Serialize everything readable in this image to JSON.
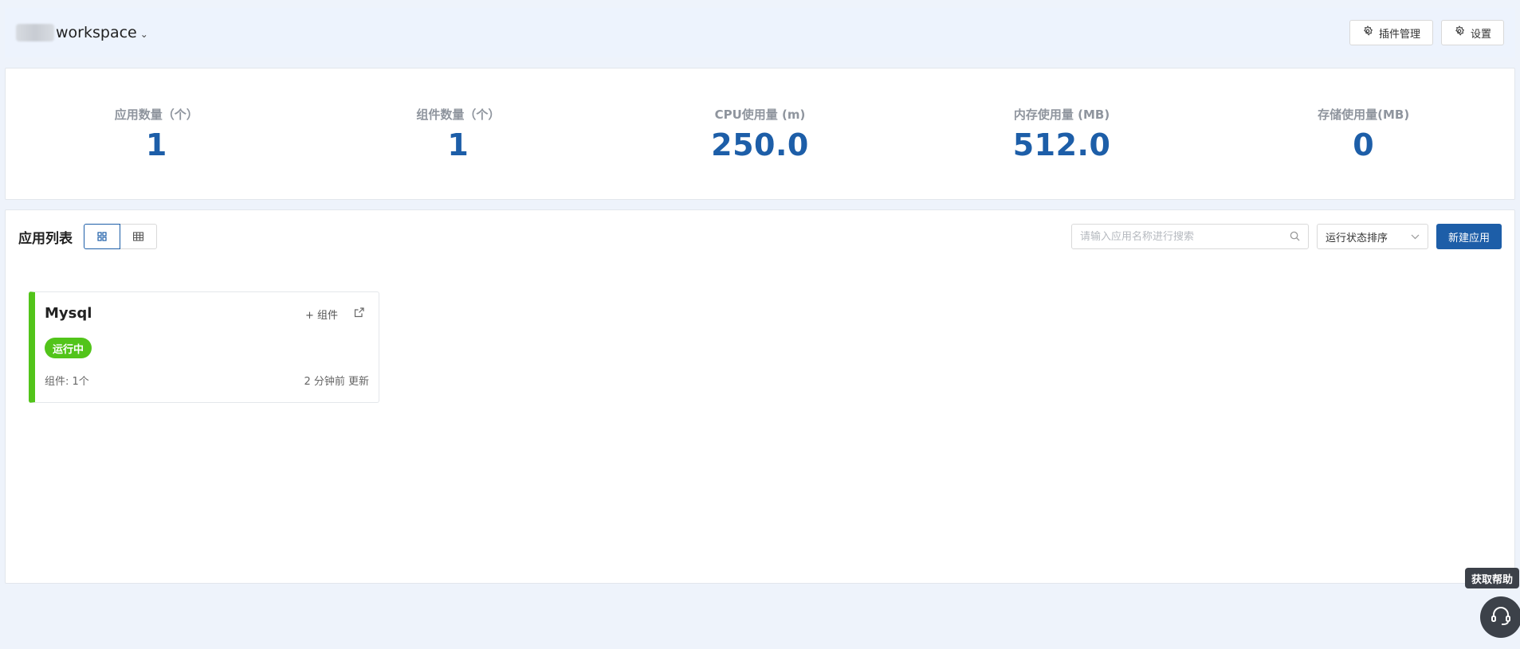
{
  "header": {
    "workspace_name": "workspace",
    "workspace_caret": "⌄",
    "plugin_button": "插件管理",
    "settings_button": "设置"
  },
  "stats": [
    {
      "label": "应用数量（个）",
      "value": "1"
    },
    {
      "label": "组件数量（个）",
      "value": "1"
    },
    {
      "label": "CPU使用量 (m)",
      "value": "250.0"
    },
    {
      "label": "内存使用量 (MB)",
      "value": "512.0"
    },
    {
      "label": "存储使用量(MB)",
      "value": "0"
    }
  ],
  "app_list": {
    "title": "应用列表",
    "search_placeholder": "请输入应用名称进行搜索",
    "sort_label": "运行状态排序",
    "new_app_button": "新建应用",
    "apps": [
      {
        "name": "Mysql",
        "add_component": "+ 组件",
        "status": "运行中",
        "status_color": "#52c41a",
        "components": "组件: 1个",
        "updated": "2 分钟前 更新"
      }
    ]
  },
  "help": {
    "tooltip": "获取帮助"
  },
  "colors": {
    "primary": "#1d5ea8",
    "running": "#52c41a",
    "header_bg": "#edf3fd"
  },
  "icons": {
    "grid_view": "grid-view-icon",
    "table_view": "table-view-icon",
    "search": "search-icon",
    "settings": "gear-icon",
    "external": "external-link-icon",
    "help": "headset-icon"
  }
}
